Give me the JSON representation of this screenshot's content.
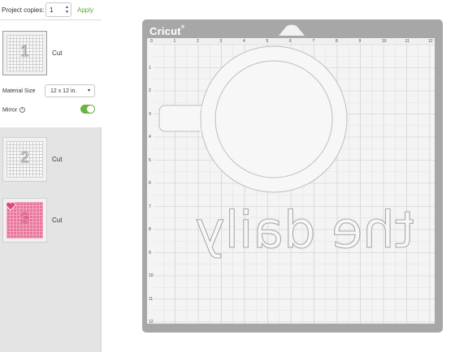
{
  "project": {
    "copies_label": "Project copies:",
    "copies_value": "1",
    "apply_label": "Apply"
  },
  "mats": [
    {
      "number": "1",
      "label": "Cut",
      "color": "#f4f4f4"
    },
    {
      "number": "2",
      "label": "Cut",
      "color": "#f4f4f4"
    },
    {
      "number": "3",
      "label": "Cut",
      "color": "#e8759a"
    }
  ],
  "material": {
    "label": "Material Size",
    "value": "12 x 12 in."
  },
  "mirror": {
    "label": "Mirror",
    "on": true
  },
  "brand": {
    "name": "Cricut",
    "accent": "#6db33f",
    "mat_frame": "#a7a7a7"
  },
  "ruler": {
    "top": [
      "0",
      "1",
      "2",
      "3",
      "4",
      "5",
      "6",
      "7",
      "8",
      "9",
      "10",
      "11",
      "12"
    ],
    "left": [
      "1",
      "2",
      "3",
      "4",
      "5",
      "6",
      "7",
      "8",
      "9",
      "10",
      "11",
      "12"
    ]
  }
}
